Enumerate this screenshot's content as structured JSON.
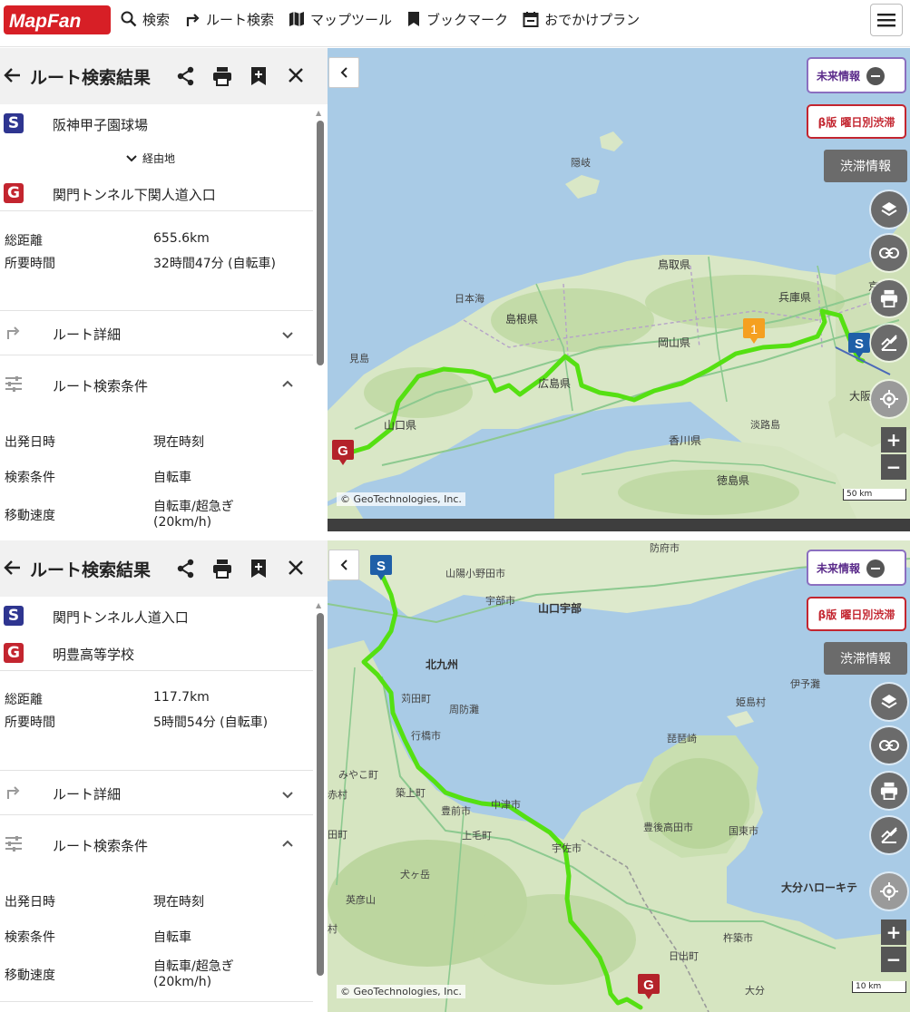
{
  "header": {
    "logo_text": "MapFan",
    "nav": [
      "検索",
      "ルート検索",
      "マップツール",
      "ブックマーク",
      "おでかけプラン"
    ]
  },
  "panels": [
    {
      "title": "ルート検索結果",
      "start": "阪神甲子園球場",
      "waypoint_toggle": "経由地",
      "goal": "関門トンネル下関人道入口",
      "distance_label": "総距離",
      "distance": "655.6km",
      "time_label": "所要時間",
      "time": "32時間47分 (自転車)",
      "route_detail": "ルート詳細",
      "conditions": "ルート検索条件",
      "depart_label": "出発日時",
      "depart": "現在時刻",
      "cond_label": "検索条件",
      "cond": "自転車",
      "speed_label": "移動速度",
      "speed_line1": "自転車/超急ぎ",
      "speed_line2": "(20km/h)",
      "map": {
        "mirai": "未来情報",
        "beta": "β版 曜日別渋滞",
        "jutai": "渋滞情報",
        "copyright": "© GeoTechnologies, Inc.",
        "scale": "50 km",
        "marker_number": "1",
        "labels": [
          "隠岐",
          "鳥取県",
          "島根県",
          "兵庫県",
          "岡山県",
          "広島県",
          "山口県",
          "香川県",
          "徳島県",
          "淡路島",
          "大阪",
          "京",
          "見島",
          "日本海"
        ]
      }
    },
    {
      "title": "ルート検索結果",
      "start": "関門トンネル人道入口",
      "goal": "明豊高等学校",
      "distance_label": "総距離",
      "distance": "117.7km",
      "time_label": "所要時間",
      "time": "5時間54分 (自転車)",
      "route_detail": "ルート詳細",
      "conditions": "ルート検索条件",
      "depart_label": "出発日時",
      "depart": "現在時刻",
      "cond_label": "検索条件",
      "cond": "自転車",
      "speed_label": "移動速度",
      "speed_line1": "自転車/超急ぎ",
      "speed_line2": "(20km/h)",
      "map": {
        "mirai": "未来情報",
        "beta": "β版 曜日別渋滞",
        "jutai": "渋滞情報",
        "copyright": "© GeoTechnologies, Inc.",
        "scale": "10 km",
        "labels": [
          "防府市",
          "山陽小野田市",
          "宇部市",
          "山口宇部",
          "北九州",
          "苅田町",
          "周防灘",
          "行橋市",
          "姫島村",
          "築上町",
          "豊前市",
          "中津市",
          "上毛町",
          "宇佐市",
          "豊後高田市",
          "国東市",
          "みやこ町",
          "赤村",
          "田町",
          "犬ヶ岳",
          "英彦山",
          "村",
          "大分ハローキテ",
          "杵築市",
          "日出町",
          "大分",
          "伊予灘",
          "琵琶崎"
        ]
      }
    }
  ]
}
